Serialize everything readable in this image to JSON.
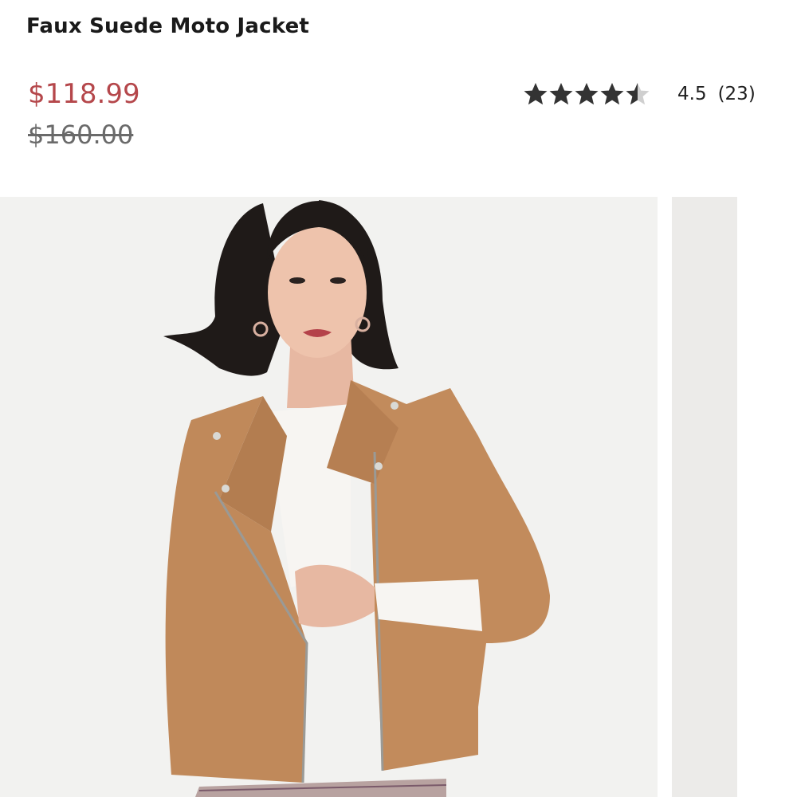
{
  "product": {
    "title": "Faux Suede Moto Jacket",
    "sale_price": "$118.99",
    "original_price": "$160.00"
  },
  "rating": {
    "stars": 4.5,
    "value_label": "4.5",
    "count_label": "(23)",
    "star_color": "#333333",
    "star_empty_color": "#cfcfcf"
  },
  "gallery": {
    "main_image_alt": "model wearing camel faux suede moto jacket",
    "background_color": "#f2f2f0",
    "jacket_color": "#c0895a"
  },
  "colors": {
    "sale_price": "#b5474b",
    "original_price": "#6a6a6a",
    "title": "#1a1a1a"
  }
}
